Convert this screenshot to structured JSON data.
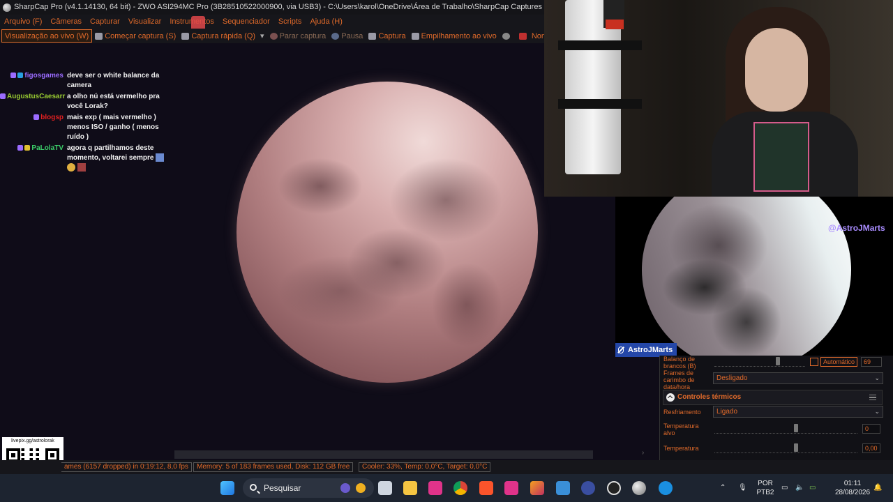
{
  "window": {
    "title": "SharpCap Pro (v4.1.14130, 64 bit) - ZWO ASI294MC Pro (3B28510522000900, via USB3) - C:\\Users\\karol\\OneDrive\\Área de Trabalho\\SharpCap Captures"
  },
  "menu": [
    "Arquivo (F)",
    "Câmeras",
    "Capturar",
    "Visualizar",
    "Instrumentos",
    "Sequenciador",
    "Scripts",
    "Ajuda (H)"
  ],
  "toolbar": {
    "live_view": "Visualização ao vivo (W)",
    "start_capture": "Começar captura (S)",
    "quick_capture": "Captura rápida (Q)",
    "stop_capture": "Parar captura",
    "pause": "Pausa",
    "snapshot": "Captura",
    "live_stack": "Empilhamento ao vivo",
    "target_name": "Nome de destino"
  },
  "chat": [
    {
      "user": "figosgames",
      "color": "#9b6cff",
      "text": "deve ser o white balance da camera"
    },
    {
      "user": "AugustusCaesarr",
      "color": "#9acd32",
      "text": "a olho nú está vermelho pra você Lorak?"
    },
    {
      "user": "blogsp",
      "color": "#e02020",
      "text": "mais exp ( mais vermelho ) menos ISO / ganho ( menos ruído )"
    },
    {
      "user": "PaLolaTV",
      "color": "#3ccf6a",
      "text": "agora q partilhamos deste momento, voltarei sempre"
    }
  ],
  "qr": {
    "url": "livepix.gg/astrolorak"
  },
  "status": {
    "frames": "ames (6157 dropped) in 0:19:12, 8,0 fps",
    "memory": "Memory: 5 of 183 frames used, Disk: 112 GB free",
    "cooler": "Cooler: 33%, Temp: 0,0°C, Target: 0,0°C"
  },
  "overlay": {
    "handle": "@AstroJMarts",
    "name_tag": "AstroJMarts"
  },
  "panel": {
    "wb_label": "Balanço de brancos (B)",
    "wb_auto": "Automático",
    "wb_value": "69",
    "timestamp_label": "Frames de carimbo de data/hora",
    "timestamp_value": "Desligado",
    "thermal_header": "Controles térmicos",
    "cooling_label": "Resfriamento",
    "cooling_value": "Ligado",
    "target_temp_label": "Temperatura alvo",
    "target_temp_value": "0",
    "temp_label": "Temperatura",
    "temp_value": "0,00"
  },
  "taskbar": {
    "search_placeholder": "Pesquisar",
    "lang_top": "POR",
    "lang_bottom": "PTB2",
    "time": "01:11",
    "date": "28/08/2026"
  },
  "colors": {
    "accent": "#e06a2a",
    "background": "#0f0d17"
  }
}
